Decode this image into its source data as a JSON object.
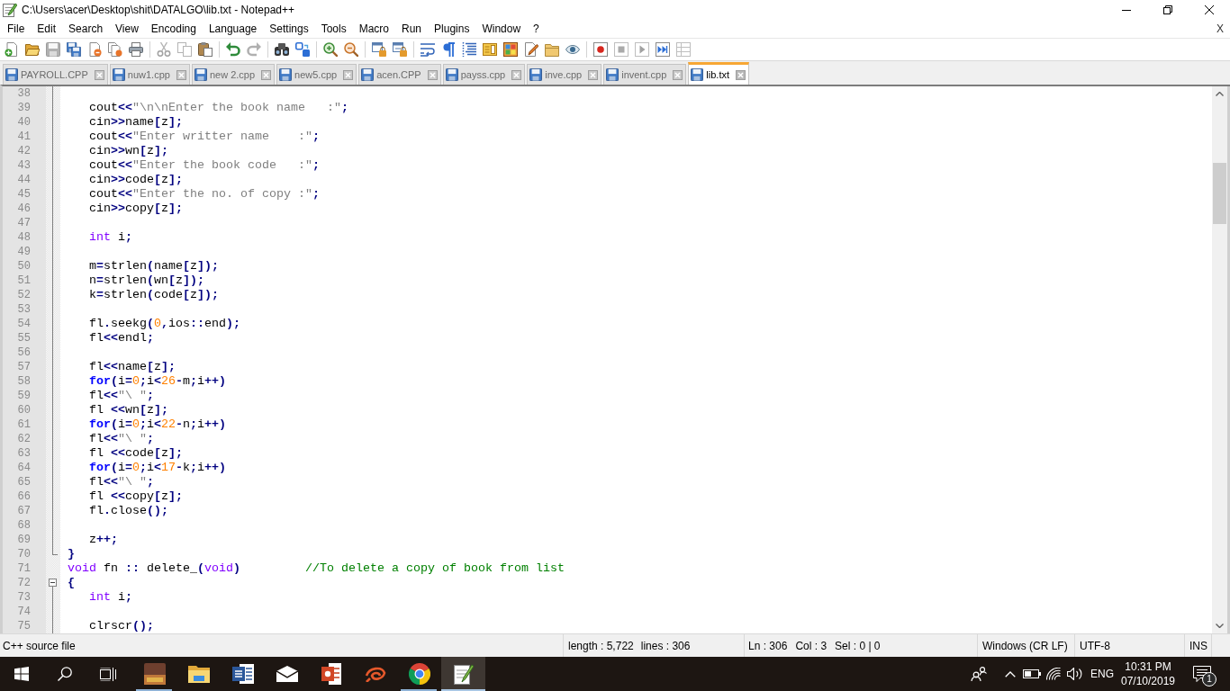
{
  "window": {
    "title": "C:\\Users\\acer\\Desktop\\shit\\DATALGO\\lib.txt - Notepad++"
  },
  "menu": {
    "items": [
      "File",
      "Edit",
      "Search",
      "View",
      "Encoding",
      "Language",
      "Settings",
      "Tools",
      "Macro",
      "Run",
      "Plugins",
      "Window",
      "?"
    ],
    "close_document": "X"
  },
  "toolbar": {
    "groups": [
      [
        {
          "kind": "new",
          "disabled": false
        },
        {
          "kind": "open",
          "disabled": false
        },
        {
          "kind": "save",
          "disabled": true
        },
        {
          "kind": "saveall",
          "disabled": false
        },
        {
          "kind": "close",
          "disabled": false
        },
        {
          "kind": "closeall",
          "disabled": false
        },
        {
          "kind": "print",
          "disabled": false
        }
      ],
      [
        {
          "kind": "cut",
          "disabled": true
        },
        {
          "kind": "copy",
          "disabled": true
        },
        {
          "kind": "paste",
          "disabled": false
        }
      ],
      [
        {
          "kind": "undo",
          "disabled": false
        },
        {
          "kind": "redo",
          "disabled": true
        }
      ],
      [
        {
          "kind": "find",
          "disabled": false
        },
        {
          "kind": "replace",
          "disabled": false
        }
      ],
      [
        {
          "kind": "zoomin",
          "disabled": false
        },
        {
          "kind": "zoomout",
          "disabled": false
        }
      ],
      [
        {
          "kind": "syncv",
          "disabled": false
        },
        {
          "kind": "synch",
          "disabled": false
        }
      ],
      [
        {
          "kind": "wrap",
          "disabled": false
        },
        {
          "kind": "allchars",
          "disabled": false
        },
        {
          "kind": "indent",
          "disabled": false
        },
        {
          "kind": "docmap",
          "disabled": false
        },
        {
          "kind": "funclist",
          "disabled": false
        },
        {
          "kind": "pen",
          "disabled": false
        },
        {
          "kind": "folder",
          "disabled": false
        },
        {
          "kind": "eye",
          "disabled": false
        }
      ],
      [
        {
          "kind": "record",
          "disabled": false
        },
        {
          "kind": "stop",
          "disabled": true
        },
        {
          "kind": "play",
          "disabled": true
        },
        {
          "kind": "playmulti",
          "disabled": false
        },
        {
          "kind": "savemacro",
          "disabled": true
        }
      ]
    ]
  },
  "tabs": [
    {
      "label": "PAYROLL.CPP",
      "selected": false
    },
    {
      "label": "nuw1.cpp",
      "selected": false
    },
    {
      "label": "new 2.cpp",
      "selected": false
    },
    {
      "label": "new5.cpp",
      "selected": false
    },
    {
      "label": "acen.CPP",
      "selected": false
    },
    {
      "label": "payss.cpp",
      "selected": false
    },
    {
      "label": "inve.cpp",
      "selected": false
    },
    {
      "label": "invent.cpp",
      "selected": false
    },
    {
      "label": "lib.txt",
      "selected": true
    }
  ],
  "editor": {
    "lines": [
      {
        "number": "38",
        "kind": "body"
      },
      {
        "number": "39",
        "kind": "body",
        "tokens": [
          {
            "kind": "identifier",
            "text": "   cout"
          },
          {
            "kind": "operator",
            "text": "<<"
          },
          {
            "kind": "string",
            "text": "\"\\n\\nEnter the book name   :\""
          },
          {
            "kind": "operator",
            "text": ";"
          }
        ]
      },
      {
        "number": "40",
        "kind": "body",
        "tokens": [
          {
            "kind": "identifier",
            "text": "   cin"
          },
          {
            "kind": "operator",
            "text": ">>"
          },
          {
            "kind": "identifier",
            "text": "name"
          },
          {
            "kind": "operator",
            "text": "["
          },
          {
            "kind": "identifier",
            "text": "z"
          },
          {
            "kind": "operator",
            "text": "];"
          }
        ]
      },
      {
        "number": "41",
        "kind": "body",
        "tokens": [
          {
            "kind": "identifier",
            "text": "   cout"
          },
          {
            "kind": "operator",
            "text": "<<"
          },
          {
            "kind": "string",
            "text": "\"Enter writter name    :\""
          },
          {
            "kind": "operator",
            "text": ";"
          }
        ]
      },
      {
        "number": "42",
        "kind": "body",
        "tokens": [
          {
            "kind": "identifier",
            "text": "   cin"
          },
          {
            "kind": "operator",
            "text": ">>"
          },
          {
            "kind": "identifier",
            "text": "wn"
          },
          {
            "kind": "operator",
            "text": "["
          },
          {
            "kind": "identifier",
            "text": "z"
          },
          {
            "kind": "operator",
            "text": "];"
          }
        ]
      },
      {
        "number": "43",
        "kind": "body",
        "tokens": [
          {
            "kind": "identifier",
            "text": "   cout"
          },
          {
            "kind": "operator",
            "text": "<<"
          },
          {
            "kind": "string",
            "text": "\"Enter the book code   :\""
          },
          {
            "kind": "operator",
            "text": ";"
          }
        ]
      },
      {
        "number": "44",
        "kind": "body",
        "tokens": [
          {
            "kind": "identifier",
            "text": "   cin"
          },
          {
            "kind": "operator",
            "text": ">>"
          },
          {
            "kind": "identifier",
            "text": "code"
          },
          {
            "kind": "operator",
            "text": "["
          },
          {
            "kind": "identifier",
            "text": "z"
          },
          {
            "kind": "operator",
            "text": "];"
          }
        ]
      },
      {
        "number": "45",
        "kind": "body",
        "tokens": [
          {
            "kind": "identifier",
            "text": "   cout"
          },
          {
            "kind": "operator",
            "text": "<<"
          },
          {
            "kind": "string",
            "text": "\"Enter the no. of copy :\""
          },
          {
            "kind": "operator",
            "text": ";"
          }
        ]
      },
      {
        "number": "46",
        "kind": "body",
        "tokens": [
          {
            "kind": "identifier",
            "text": "   cin"
          },
          {
            "kind": "operator",
            "text": ">>"
          },
          {
            "kind": "identifier",
            "text": "copy"
          },
          {
            "kind": "operator",
            "text": "["
          },
          {
            "kind": "identifier",
            "text": "z"
          },
          {
            "kind": "operator",
            "text": "];"
          }
        ]
      },
      {
        "number": "47",
        "kind": "body"
      },
      {
        "number": "48",
        "kind": "body",
        "tokens": [
          {
            "kind": "type",
            "text": "   int"
          },
          {
            "kind": "identifier",
            "text": " i"
          },
          {
            "kind": "operator",
            "text": ";"
          }
        ]
      },
      {
        "number": "49",
        "kind": "body"
      },
      {
        "number": "50",
        "kind": "body",
        "tokens": [
          {
            "kind": "identifier",
            "text": "   m"
          },
          {
            "kind": "operator",
            "text": "="
          },
          {
            "kind": "identifier",
            "text": "strlen"
          },
          {
            "kind": "operator",
            "text": "("
          },
          {
            "kind": "identifier",
            "text": "name"
          },
          {
            "kind": "operator",
            "text": "["
          },
          {
            "kind": "identifier",
            "text": "z"
          },
          {
            "kind": "operator",
            "text": "]);"
          }
        ]
      },
      {
        "number": "51",
        "kind": "body",
        "tokens": [
          {
            "kind": "identifier",
            "text": "   n"
          },
          {
            "kind": "operator",
            "text": "="
          },
          {
            "kind": "identifier",
            "text": "strlen"
          },
          {
            "kind": "operator",
            "text": "("
          },
          {
            "kind": "identifier",
            "text": "wn"
          },
          {
            "kind": "operator",
            "text": "["
          },
          {
            "kind": "identifier",
            "text": "z"
          },
          {
            "kind": "operator",
            "text": "]);"
          }
        ]
      },
      {
        "number": "52",
        "kind": "body",
        "tokens": [
          {
            "kind": "identifier",
            "text": "   k"
          },
          {
            "kind": "operator",
            "text": "="
          },
          {
            "kind": "identifier",
            "text": "strlen"
          },
          {
            "kind": "operator",
            "text": "("
          },
          {
            "kind": "identifier",
            "text": "code"
          },
          {
            "kind": "operator",
            "text": "["
          },
          {
            "kind": "identifier",
            "text": "z"
          },
          {
            "kind": "operator",
            "text": "]);"
          }
        ]
      },
      {
        "number": "53",
        "kind": "body"
      },
      {
        "number": "54",
        "kind": "body",
        "tokens": [
          {
            "kind": "identifier",
            "text": "   fl"
          },
          {
            "kind": "operator",
            "text": "."
          },
          {
            "kind": "identifier",
            "text": "seekg"
          },
          {
            "kind": "operator",
            "text": "("
          },
          {
            "kind": "number",
            "text": "0"
          },
          {
            "kind": "operator",
            "text": ","
          },
          {
            "kind": "identifier",
            "text": "ios"
          },
          {
            "kind": "operator",
            "text": "::"
          },
          {
            "kind": "identifier",
            "text": "end"
          },
          {
            "kind": "operator",
            "text": ");"
          }
        ]
      },
      {
        "number": "55",
        "kind": "body",
        "tokens": [
          {
            "kind": "identifier",
            "text": "   fl"
          },
          {
            "kind": "operator",
            "text": "<<"
          },
          {
            "kind": "identifier",
            "text": "endl"
          },
          {
            "kind": "operator",
            "text": ";"
          }
        ]
      },
      {
        "number": "56",
        "kind": "body"
      },
      {
        "number": "57",
        "kind": "body",
        "tokens": [
          {
            "kind": "identifier",
            "text": "   fl"
          },
          {
            "kind": "operator",
            "text": "<<"
          },
          {
            "kind": "identifier",
            "text": "name"
          },
          {
            "kind": "operator",
            "text": "["
          },
          {
            "kind": "identifier",
            "text": "z"
          },
          {
            "kind": "operator",
            "text": "];"
          }
        ]
      },
      {
        "number": "58",
        "kind": "body",
        "tokens": [
          {
            "kind": "keyword",
            "text": "   for"
          },
          {
            "kind": "operator",
            "text": "("
          },
          {
            "kind": "identifier",
            "text": "i"
          },
          {
            "kind": "operator",
            "text": "="
          },
          {
            "kind": "number",
            "text": "0"
          },
          {
            "kind": "operator",
            "text": ";"
          },
          {
            "kind": "identifier",
            "text": "i"
          },
          {
            "kind": "operator",
            "text": "<"
          },
          {
            "kind": "number",
            "text": "26"
          },
          {
            "kind": "operator",
            "text": "-"
          },
          {
            "kind": "identifier",
            "text": "m"
          },
          {
            "kind": "operator",
            "text": ";"
          },
          {
            "kind": "identifier",
            "text": "i"
          },
          {
            "kind": "operator",
            "text": "++)"
          }
        ]
      },
      {
        "number": "59",
        "kind": "body",
        "tokens": [
          {
            "kind": "identifier",
            "text": "   fl"
          },
          {
            "kind": "operator",
            "text": "<<"
          },
          {
            "kind": "string",
            "text": "\"\\ \""
          },
          {
            "kind": "operator",
            "text": ";"
          }
        ]
      },
      {
        "number": "60",
        "kind": "body",
        "tokens": [
          {
            "kind": "identifier",
            "text": "   fl "
          },
          {
            "kind": "operator",
            "text": "<<"
          },
          {
            "kind": "identifier",
            "text": "wn"
          },
          {
            "kind": "operator",
            "text": "["
          },
          {
            "kind": "identifier",
            "text": "z"
          },
          {
            "kind": "operator",
            "text": "];"
          }
        ]
      },
      {
        "number": "61",
        "kind": "body",
        "tokens": [
          {
            "kind": "keyword",
            "text": "   for"
          },
          {
            "kind": "operator",
            "text": "("
          },
          {
            "kind": "identifier",
            "text": "i"
          },
          {
            "kind": "operator",
            "text": "="
          },
          {
            "kind": "number",
            "text": "0"
          },
          {
            "kind": "operator",
            "text": ";"
          },
          {
            "kind": "identifier",
            "text": "i"
          },
          {
            "kind": "operator",
            "text": "<"
          },
          {
            "kind": "number",
            "text": "22"
          },
          {
            "kind": "operator",
            "text": "-"
          },
          {
            "kind": "identifier",
            "text": "n"
          },
          {
            "kind": "operator",
            "text": ";"
          },
          {
            "kind": "identifier",
            "text": "i"
          },
          {
            "kind": "operator",
            "text": "++)"
          }
        ]
      },
      {
        "number": "62",
        "kind": "body",
        "tokens": [
          {
            "kind": "identifier",
            "text": "   fl"
          },
          {
            "kind": "operator",
            "text": "<<"
          },
          {
            "kind": "string",
            "text": "\"\\ \""
          },
          {
            "kind": "operator",
            "text": ";"
          }
        ]
      },
      {
        "number": "63",
        "kind": "body",
        "tokens": [
          {
            "kind": "identifier",
            "text": "   fl "
          },
          {
            "kind": "operator",
            "text": "<<"
          },
          {
            "kind": "identifier",
            "text": "code"
          },
          {
            "kind": "operator",
            "text": "["
          },
          {
            "kind": "identifier",
            "text": "z"
          },
          {
            "kind": "operator",
            "text": "];"
          }
        ]
      },
      {
        "number": "64",
        "kind": "body",
        "tokens": [
          {
            "kind": "keyword",
            "text": "   for"
          },
          {
            "kind": "operator",
            "text": "("
          },
          {
            "kind": "identifier",
            "text": "i"
          },
          {
            "kind": "operator",
            "text": "="
          },
          {
            "kind": "number",
            "text": "0"
          },
          {
            "kind": "operator",
            "text": ";"
          },
          {
            "kind": "identifier",
            "text": "i"
          },
          {
            "kind": "operator",
            "text": "<"
          },
          {
            "kind": "number",
            "text": "17"
          },
          {
            "kind": "operator",
            "text": "-"
          },
          {
            "kind": "identifier",
            "text": "k"
          },
          {
            "kind": "operator",
            "text": ";"
          },
          {
            "kind": "identifier",
            "text": "i"
          },
          {
            "kind": "operator",
            "text": "++)"
          }
        ]
      },
      {
        "number": "65",
        "kind": "body",
        "tokens": [
          {
            "kind": "identifier",
            "text": "   fl"
          },
          {
            "kind": "operator",
            "text": "<<"
          },
          {
            "kind": "string",
            "text": "\"\\ \""
          },
          {
            "kind": "operator",
            "text": ";"
          }
        ]
      },
      {
        "number": "66",
        "kind": "body",
        "tokens": [
          {
            "kind": "identifier",
            "text": "   fl "
          },
          {
            "kind": "operator",
            "text": "<<"
          },
          {
            "kind": "identifier",
            "text": "copy"
          },
          {
            "kind": "operator",
            "text": "["
          },
          {
            "kind": "identifier",
            "text": "z"
          },
          {
            "kind": "operator",
            "text": "];"
          }
        ]
      },
      {
        "number": "67",
        "kind": "body",
        "tokens": [
          {
            "kind": "identifier",
            "text": "   fl"
          },
          {
            "kind": "operator",
            "text": "."
          },
          {
            "kind": "identifier",
            "text": "close"
          },
          {
            "kind": "operator",
            "text": "();"
          }
        ]
      },
      {
        "number": "68",
        "kind": "body"
      },
      {
        "number": "69",
        "kind": "body",
        "tokens": [
          {
            "kind": "identifier",
            "text": "   z"
          },
          {
            "kind": "operator",
            "text": "++;"
          }
        ]
      },
      {
        "number": "70",
        "kind": "end",
        "tokens": [
          {
            "kind": "operator",
            "text": "}"
          }
        ]
      },
      {
        "number": "71",
        "kind": "plain",
        "tokens": [
          {
            "kind": "type",
            "text": "void"
          },
          {
            "kind": "identifier",
            "text": " fn "
          },
          {
            "kind": "operator",
            "text": "::"
          },
          {
            "kind": "identifier",
            "text": " delete_"
          },
          {
            "kind": "operator",
            "text": "("
          },
          {
            "kind": "type",
            "text": "void"
          },
          {
            "kind": "operator",
            "text": ")"
          },
          {
            "kind": "comment",
            "text": "         //To delete a copy of book from list"
          }
        ]
      },
      {
        "number": "72",
        "kind": "start",
        "tokens": [
          {
            "kind": "operator",
            "text": "{"
          }
        ]
      },
      {
        "number": "73",
        "kind": "body",
        "tokens": [
          {
            "kind": "type",
            "text": "   int"
          },
          {
            "kind": "identifier",
            "text": " i"
          },
          {
            "kind": "operator",
            "text": ";"
          }
        ]
      },
      {
        "number": "74",
        "kind": "body"
      },
      {
        "number": "75",
        "kind": "body",
        "tokens": [
          {
            "kind": "identifier",
            "text": "   clrscr"
          },
          {
            "kind": "operator",
            "text": "();"
          }
        ]
      }
    ]
  },
  "status_bar": {
    "file_type": "C++ source file",
    "length": "length : 5,722",
    "lines": "lines : 306",
    "line": "Ln : 306",
    "column": "Col : 3",
    "selection": "Sel : 0 | 0",
    "eol": "Windows (CR LF)",
    "encoding": "UTF-8",
    "mode": "INS"
  },
  "taskbar": {
    "apps": [
      {
        "kind": "picture",
        "running": true,
        "selected": false
      },
      {
        "kind": "folder",
        "running": false,
        "selected": false
      },
      {
        "kind": "document",
        "running": false,
        "selected": false
      },
      {
        "kind": "envelope",
        "running": false,
        "selected": false
      },
      {
        "kind": "presentation",
        "running": false,
        "selected": false
      },
      {
        "kind": "swirl",
        "running": false,
        "selected": false
      },
      {
        "kind": "ring",
        "running": true,
        "selected": false
      },
      {
        "kind": "notepad",
        "running": true,
        "selected": true
      }
    ],
    "language": "ENG",
    "time": "10:31 PM",
    "date": "07/10/2019",
    "notifications": "1"
  }
}
